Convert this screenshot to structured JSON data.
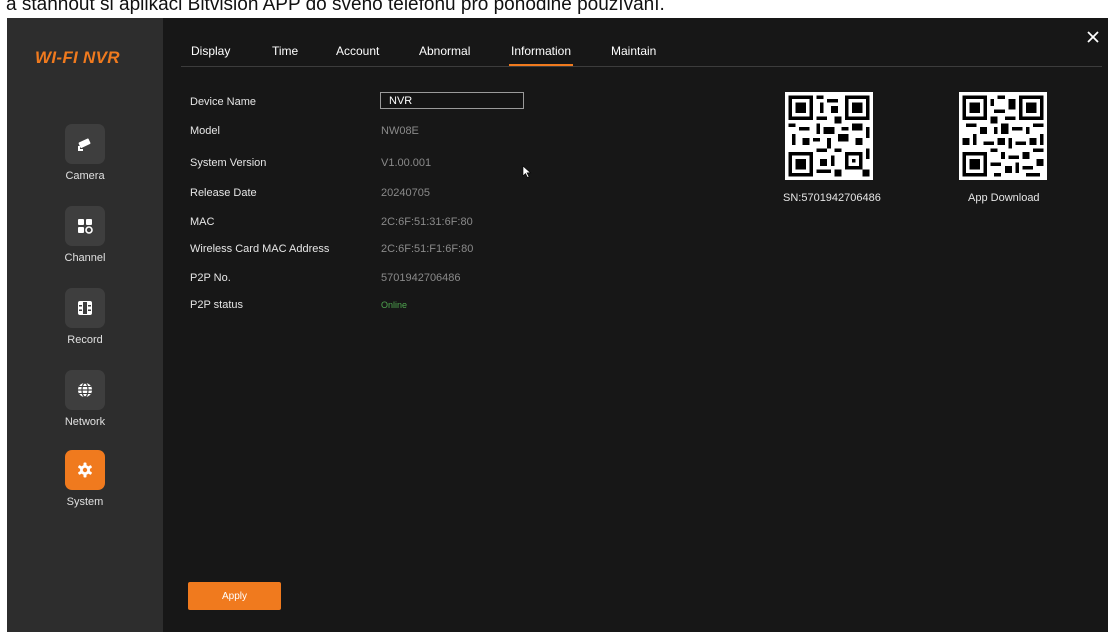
{
  "caption": "a stáhnout si aplikaci Bitvision APP do svého telefonu pro pohodlné používání.",
  "app": {
    "logo": "WI-FI NVR"
  },
  "colors": {
    "accent": "#f07a1e",
    "online": "#4fa64f",
    "background": "#171717",
    "sidebar": "#2d2d2d"
  },
  "sidebar": {
    "items": [
      {
        "label": "Camera",
        "icon": "camera-icon",
        "active": false
      },
      {
        "label": "Channel",
        "icon": "grid-icon",
        "active": false
      },
      {
        "label": "Record",
        "icon": "film-icon",
        "active": false
      },
      {
        "label": "Network",
        "icon": "globe-icon",
        "active": false
      },
      {
        "label": "System",
        "icon": "gear-icon",
        "active": true
      }
    ]
  },
  "tabs": [
    {
      "label": "Display",
      "active": false
    },
    {
      "label": "Time",
      "active": false
    },
    {
      "label": "Account",
      "active": false
    },
    {
      "label": "Abnormal",
      "active": false
    },
    {
      "label": "Information",
      "active": true
    },
    {
      "label": "Maintain",
      "active": false
    }
  ],
  "info": {
    "device_name": {
      "label": "Device Name",
      "value": "NVR"
    },
    "model": {
      "label": "Model",
      "value": "NW08E"
    },
    "system_version": {
      "label": "System Version",
      "value": "V1.00.001"
    },
    "release_date": {
      "label": "Release Date",
      "value": "20240705"
    },
    "mac": {
      "label": "MAC",
      "value": "2C:6F:51:31:6F:80"
    },
    "wireless_mac": {
      "label": "Wireless Card MAC Address",
      "value": "2C:6F:51:F1:6F:80"
    },
    "p2p_no": {
      "label": "P2P No.",
      "value": "5701942706486"
    },
    "p2p_status": {
      "label": "P2P status",
      "value": "Online"
    }
  },
  "qr": {
    "sn_caption": "SN:5701942706486",
    "app_caption": "App Download"
  },
  "buttons": {
    "apply": "Apply",
    "close": "×"
  }
}
